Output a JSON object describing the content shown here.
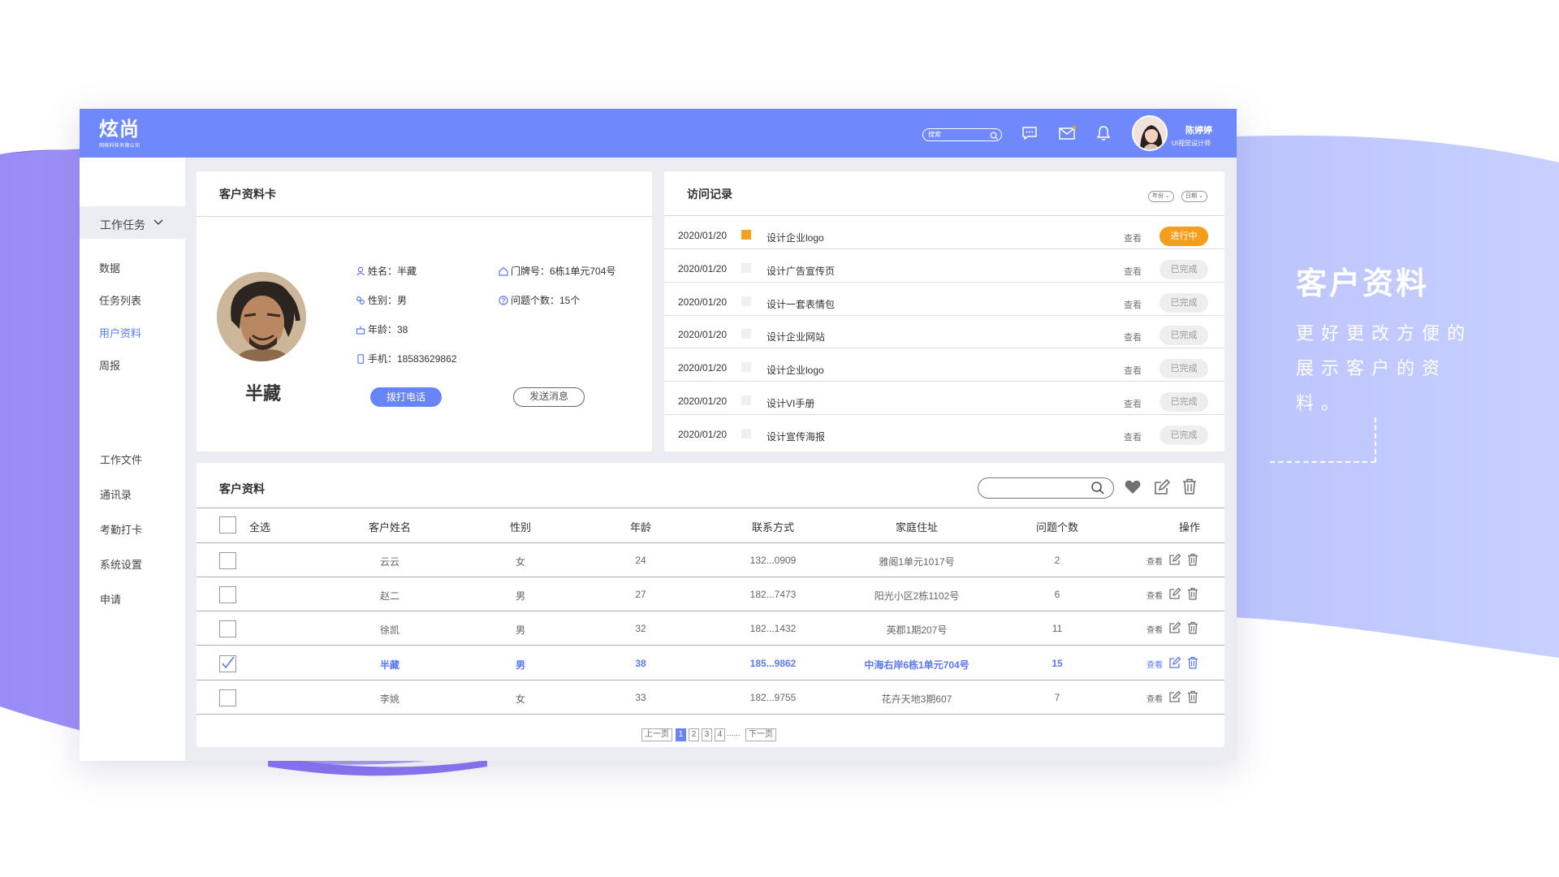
{
  "colors": {
    "brand": "#6f88fb",
    "accent_blue": "#5a78f5",
    "in_progress": "#f59d1c",
    "background_gradient": [
      "#8c6ff5",
      "#b5c1ff"
    ]
  },
  "topbar": {
    "logo_main": "炫尚",
    "logo_sub": "网络科技有限公司",
    "search_placeholder": "搜索",
    "icons": [
      "search-icon",
      "message-icon",
      "mail-icon",
      "bell-icon"
    ],
    "user_name": "陈婷婷",
    "user_role": "UI视觉设计师"
  },
  "sidebar": {
    "section_label": "工作任务",
    "items": [
      {
        "label": "数据",
        "active": false
      },
      {
        "label": "任务列表",
        "active": false
      },
      {
        "label": "用户资料",
        "active": true
      },
      {
        "label": "周报",
        "active": false
      }
    ],
    "items2": [
      "工作文件",
      "通讯录",
      "考勤打卡",
      "系统设置",
      "申请"
    ]
  },
  "profile_card": {
    "title": "客户资料卡",
    "name": "半藏",
    "fields": {
      "name": "姓名：半藏",
      "gender": "性别：男",
      "age": "年龄：38",
      "phone": "手机：18583629862",
      "door": "门牌号：6栋1单元704号",
      "issues": "问题个数：15个"
    },
    "call_button": "拨打电话",
    "message_button": "发送消息"
  },
  "visit_card": {
    "title": "访问记录",
    "filter_year": "年份",
    "filter_date": "日期",
    "view_label": "查看",
    "rows": [
      {
        "date": "2020/01/20",
        "task": "设计企业logo",
        "status": "进行中",
        "hot": true
      },
      {
        "date": "2020/01/20",
        "task": "设计广告宣传页",
        "status": "已完成",
        "hot": false
      },
      {
        "date": "2020/01/20",
        "task": "设计一套表情包",
        "status": "已完成",
        "hot": false
      },
      {
        "date": "2020/01/20",
        "task": "设计企业网站",
        "status": "已完成",
        "hot": false
      },
      {
        "date": "2020/01/20",
        "task": "设计企业logo",
        "status": "已完成",
        "hot": false
      },
      {
        "date": "2020/01/20",
        "task": "设计VI手册",
        "status": "已完成",
        "hot": false
      },
      {
        "date": "2020/01/20",
        "task": "设计宣传海报",
        "status": "已完成",
        "hot": false
      }
    ]
  },
  "table_card": {
    "title": "客户资料",
    "columns": [
      "全选",
      "客户姓名",
      "性别",
      "年龄",
      "联系方式",
      "家庭住址",
      "问题个数",
      "操作"
    ],
    "view_label": "查看",
    "rows": [
      {
        "name": "云云",
        "gender": "女",
        "age": "24",
        "contact": "132...0909",
        "address": "雅阁1单元1017号",
        "issues": "2",
        "checked": false
      },
      {
        "name": "赵二",
        "gender": "男",
        "age": "27",
        "contact": "182...7473",
        "address": "阳光小区2栋1102号",
        "issues": "6",
        "checked": false
      },
      {
        "name": "徐凯",
        "gender": "男",
        "age": "32",
        "contact": "182...1432",
        "address": "英郡1期207号",
        "issues": "11",
        "checked": false
      },
      {
        "name": "半藏",
        "gender": "男",
        "age": "38",
        "contact": "185...9862",
        "address": "中海右岸6栋1单元704号",
        "issues": "15",
        "checked": true
      },
      {
        "name": "李姚",
        "gender": "女",
        "age": "33",
        "contact": "182...9755",
        "address": "花卉天地3期607",
        "issues": "7",
        "checked": false
      }
    ],
    "pager": {
      "prev": "上一页",
      "pages": [
        "1",
        "2",
        "3",
        "4"
      ],
      "ellipsis": "......",
      "next": "下一页",
      "current": "1"
    }
  },
  "promo": {
    "title": "客户资料",
    "line1": "更好更改方便的",
    "line2": "展示客户的资",
    "line3": "料。"
  }
}
